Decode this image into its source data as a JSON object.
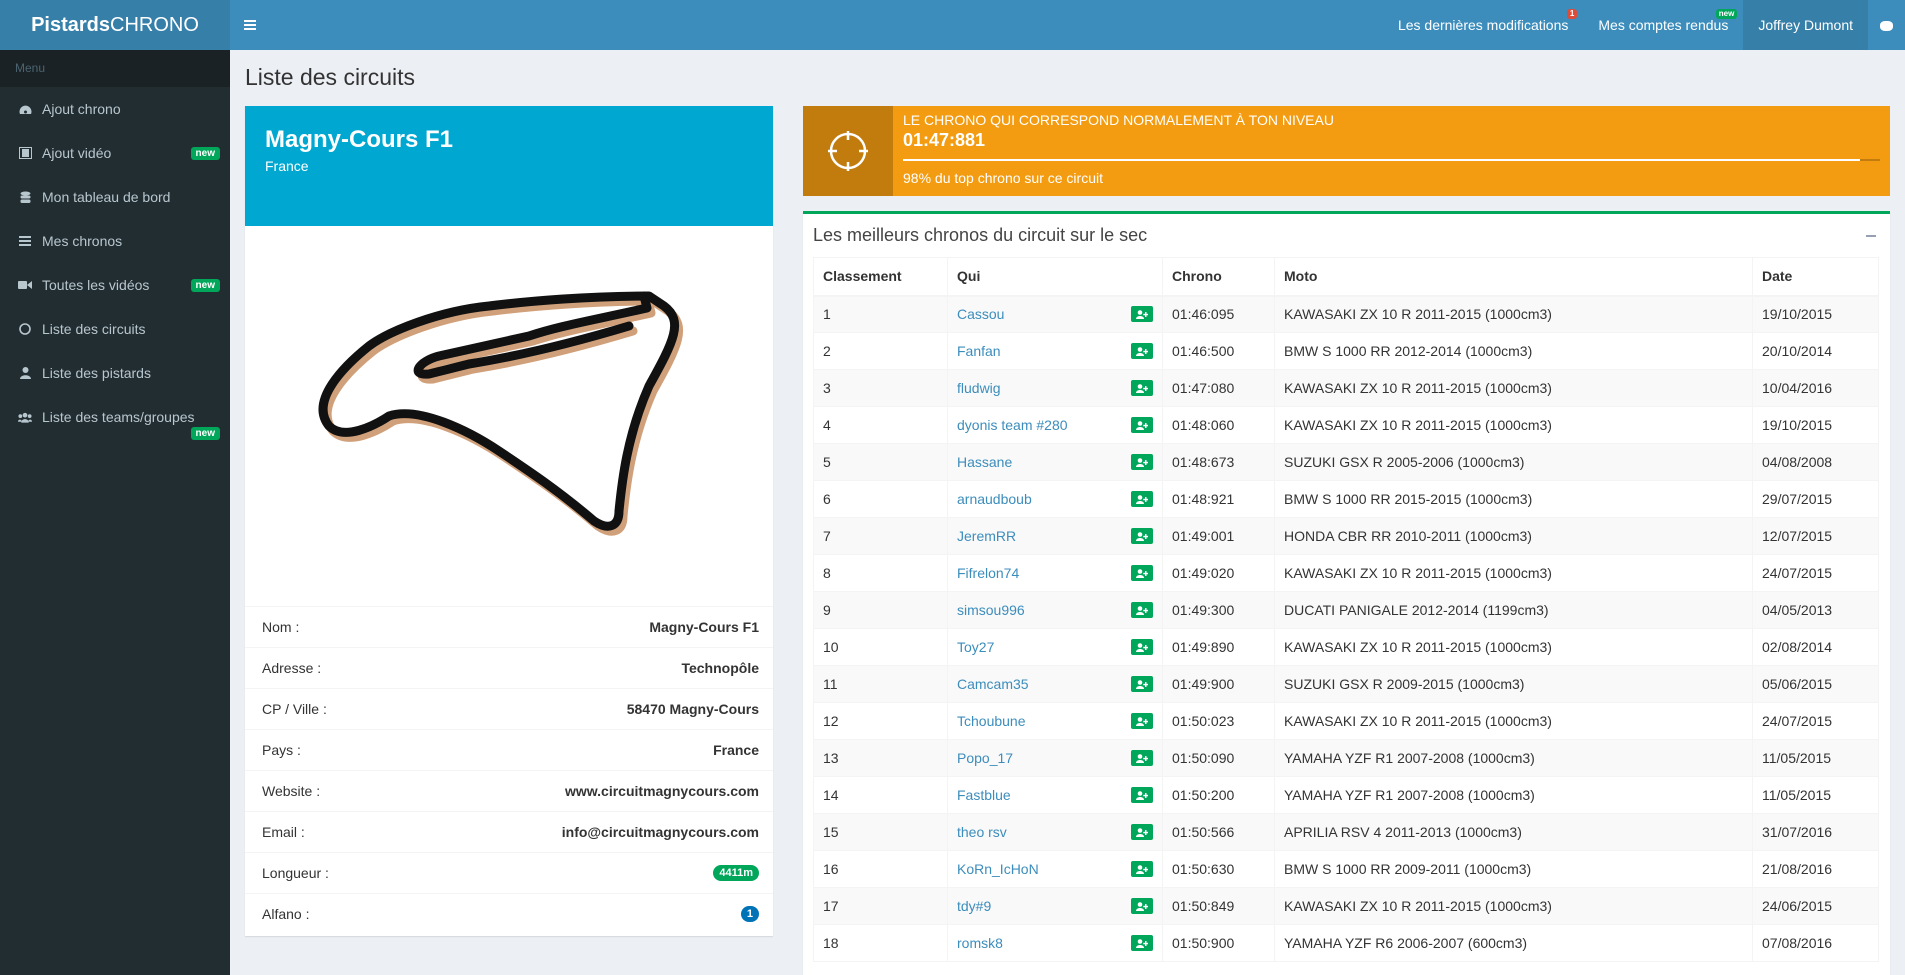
{
  "header": {
    "logo_bold": "Pistards",
    "logo_rest": "CHRONO",
    "nav": [
      {
        "label": "Les dernières modifications",
        "badge": "1"
      },
      {
        "label": "Mes comptes rendus",
        "badge": "new"
      },
      {
        "label": "Joffrey Dumont"
      }
    ]
  },
  "sidebar": {
    "heading": "Menu",
    "items": [
      {
        "label": "Ajout chrono",
        "icon": "dashboard-icon"
      },
      {
        "label": "Ajout vidéo",
        "icon": "film-icon",
        "badge": "new"
      },
      {
        "label": "Mon tableau de bord",
        "icon": "database-icon"
      },
      {
        "label": "Mes chronos",
        "icon": "list-icon"
      },
      {
        "label": "Toutes les vidéos",
        "icon": "video-icon",
        "badge": "new"
      },
      {
        "label": "Liste des circuits",
        "icon": "circle-icon"
      },
      {
        "label": "Liste des pistards",
        "icon": "user-icon"
      },
      {
        "label": "Liste des teams/groupes",
        "icon": "users-icon",
        "badge": "new"
      }
    ]
  },
  "page": {
    "title": "Liste des circuits"
  },
  "circuit": {
    "name": "Magny-Cours F1",
    "country": "France",
    "info": [
      {
        "label": "Nom :",
        "value": "Magny-Cours F1"
      },
      {
        "label": "Adresse :",
        "value": "Technopôle"
      },
      {
        "label": "CP / Ville :",
        "value": "58470 Magny-Cours"
      },
      {
        "label": "Pays :",
        "value": "France"
      },
      {
        "label": "Website :",
        "value": "www.circuitmagnycours.com"
      },
      {
        "label": "Email :",
        "value": "info@circuitmagnycours.com"
      },
      {
        "label": "Longueur :",
        "value": "4411m"
      },
      {
        "label": "Alfano :",
        "value": "1"
      }
    ]
  },
  "level_box": {
    "title": "LE CHRONO QUI CORRESPOND NORMALEMENT À TON NIVEAU",
    "chrono": "01:47:881",
    "progress": 0.98,
    "desc": "98% du top chrono sur ce circuit"
  },
  "best": {
    "title": "Les meilleurs chronos du circuit sur le sec",
    "columns": [
      "Classement",
      "Qui",
      "Chrono",
      "Moto",
      "Date"
    ],
    "rows": [
      [
        "1",
        "Cassou",
        "01:46:095",
        "KAWASAKI ZX 10 R 2011-2015 (1000cm3)",
        "19/10/2015"
      ],
      [
        "2",
        "Fanfan",
        "01:46:500",
        "BMW S 1000 RR 2012-2014 (1000cm3)",
        "20/10/2014"
      ],
      [
        "3",
        "fludwig",
        "01:47:080",
        "KAWASAKI ZX 10 R 2011-2015 (1000cm3)",
        "10/04/2016"
      ],
      [
        "4",
        "dyonis team #280",
        "01:48:060",
        "KAWASAKI ZX 10 R 2011-2015 (1000cm3)",
        "19/10/2015"
      ],
      [
        "5",
        "Hassane",
        "01:48:673",
        "SUZUKI GSX R 2005-2006 (1000cm3)",
        "04/08/2008"
      ],
      [
        "6",
        "arnaudboub",
        "01:48:921",
        "BMW S 1000 RR 2015-2015 (1000cm3)",
        "29/07/2015"
      ],
      [
        "7",
        "JeremRR",
        "01:49:001",
        "HONDA CBR RR 2010-2011 (1000cm3)",
        "12/07/2015"
      ],
      [
        "8",
        "Fifrelon74",
        "01:49:020",
        "KAWASAKI ZX 10 R 2011-2015 (1000cm3)",
        "24/07/2015"
      ],
      [
        "9",
        "simsou996",
        "01:49:300",
        "DUCATI PANIGALE 2012-2014 (1199cm3)",
        "04/05/2013"
      ],
      [
        "10",
        "Toy27",
        "01:49:890",
        "KAWASAKI ZX 10 R 2011-2015 (1000cm3)",
        "02/08/2014"
      ],
      [
        "11",
        "Camcam35",
        "01:49:900",
        "SUZUKI GSX R 2009-2015 (1000cm3)",
        "05/06/2015"
      ],
      [
        "12",
        "Tchoubune",
        "01:50:023",
        "KAWASAKI ZX 10 R 2011-2015 (1000cm3)",
        "24/07/2015"
      ],
      [
        "13",
        "Popo_17",
        "01:50:090",
        "YAMAHA YZF R1 2007-2008 (1000cm3)",
        "11/05/2015"
      ],
      [
        "14",
        "Fastblue",
        "01:50:200",
        "YAMAHA YZF R1 2007-2008 (1000cm3)",
        "11/05/2015"
      ],
      [
        "15",
        "theo rsv",
        "01:50:566",
        "APRILIA RSV 4 2011-2013 (1000cm3)",
        "31/07/2016"
      ],
      [
        "16",
        "KoRn_IcHoN",
        "01:50:630",
        "BMW S 1000 RR 2009-2011 (1000cm3)",
        "21/08/2016"
      ],
      [
        "17",
        "tdy#9",
        "01:50:849",
        "KAWASAKI ZX 10 R 2011-2015 (1000cm3)",
        "24/06/2015"
      ],
      [
        "18",
        "romsk8",
        "01:50:900",
        "YAMAHA YZF R6 2006-2007 (600cm3)",
        "07/08/2016"
      ]
    ]
  }
}
